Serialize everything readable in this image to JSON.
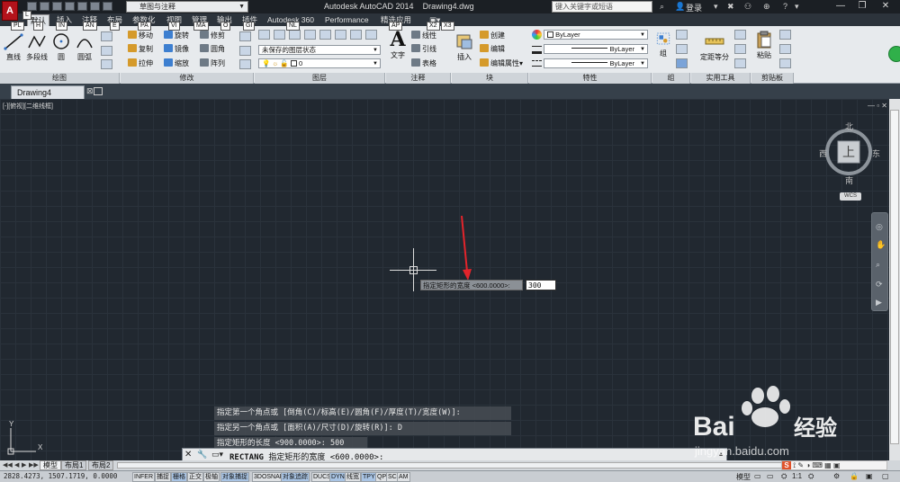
{
  "titlebar": {
    "app_button": "A",
    "workspace": "草图与注释",
    "window_title": "Autodesk AutoCAD 2014    Drawing4.dwg",
    "search_placeholder": "键入关键字或短语",
    "login": "登录"
  },
  "ribbon_tabs": [
    {
      "label": "默认",
      "active": true
    },
    {
      "label": "插入"
    },
    {
      "label": "注释"
    },
    {
      "label": "布局"
    },
    {
      "label": "参数化"
    },
    {
      "label": "视图"
    },
    {
      "label": "管理"
    },
    {
      "label": "输出"
    },
    {
      "label": "插件"
    },
    {
      "label": "Autodesk 360"
    },
    {
      "label": "Performance"
    },
    {
      "label": "精选应用"
    }
  ],
  "keytips": [
    "L",
    "PL",
    "H",
    "IN",
    "AN",
    "E",
    "PA",
    "VI",
    "MA",
    "O",
    "GI",
    "NL",
    "AP",
    "X2",
    "X3"
  ],
  "ribbon": {
    "draw": {
      "title": "绘图",
      "line": "直线",
      "polyline": "多段线",
      "circle": "圆",
      "arc": "圆弧"
    },
    "modify": {
      "title": "修改",
      "move": "移动",
      "rotate": "旋转",
      "trim": "修剪",
      "copy": "复制",
      "mirror": "镜像",
      "fillet": "圆角",
      "stretch": "拉伸",
      "scale": "缩放",
      "array": "阵列"
    },
    "layers": {
      "title": "图层",
      "layer_state": "未保存的图层状态",
      "current_layer": "0"
    },
    "annotation": {
      "title": "注释",
      "text": "文字",
      "linear": "线性",
      "leader": "引线",
      "table": "表格"
    },
    "block": {
      "title": "块",
      "insert": "插入",
      "create": "创建",
      "edit": "编辑",
      "edit_attributes": "编辑属性"
    },
    "properties": {
      "title": "特性",
      "color": "ByLayer",
      "linetype": "ByLayer",
      "lineweight": "ByLayer"
    },
    "groups": {
      "title": "组",
      "group": "组"
    },
    "utilities": {
      "title": "实用工具",
      "measure": "定距等分"
    },
    "clipboard": {
      "title": "剪贴板",
      "paste": "粘贴"
    }
  },
  "doc_tab": "Drawing4",
  "viewport": {
    "label": "[-][俯视][二维线框]",
    "controls": "— ▫ ✕"
  },
  "viewcube": {
    "north": "北",
    "south": "南",
    "east": "东",
    "west": "西",
    "top": "上",
    "wcs": "WCS"
  },
  "ucs": {
    "x": "X",
    "y": "Y"
  },
  "dynamic_input": {
    "prompt": "指定矩形的宽度 <600.0000>:",
    "value": "300"
  },
  "command_history": [
    "指定第一个角点或 [倒角(C)/标高(E)/圆角(F)/厚度(T)/宽度(W)]:",
    "指定另一个角点或 [面积(A)/尺寸(D)/旋转(R)]: D",
    "指定矩形的长度 <900.0000>: 500"
  ],
  "command_line": {
    "command": "RECTANG",
    "prompt": "指定矩形的宽度 <600.0000>:"
  },
  "layout_tabs": [
    "模型",
    "布局1",
    "布局2"
  ],
  "status": {
    "coords": "2828.4273, 1507.1719, 0.0000",
    "toggles": [
      {
        "label": "INFER",
        "on": false
      },
      {
        "label": "捕捉",
        "on": false
      },
      {
        "label": "栅格",
        "on": true
      },
      {
        "label": "正交",
        "on": false
      },
      {
        "label": "极轴",
        "on": false
      },
      {
        "label": "对象捕捉",
        "on": true
      },
      {
        "label": "3DOSNAP",
        "on": false
      },
      {
        "label": "对象追踪",
        "on": true
      },
      {
        "label": "DUCS",
        "on": false
      },
      {
        "label": "DYN",
        "on": true
      },
      {
        "label": "线宽",
        "on": false
      },
      {
        "label": "TPY",
        "on": true
      },
      {
        "label": "QP",
        "on": false
      },
      {
        "label": "SC",
        "on": false
      },
      {
        "label": "AM",
        "on": false
      }
    ],
    "model": "模型",
    "scale": "1:1"
  },
  "watermark": {
    "brand": "Bai",
    "brand_cn": "经验",
    "url": "jingyan.baidu.com"
  }
}
